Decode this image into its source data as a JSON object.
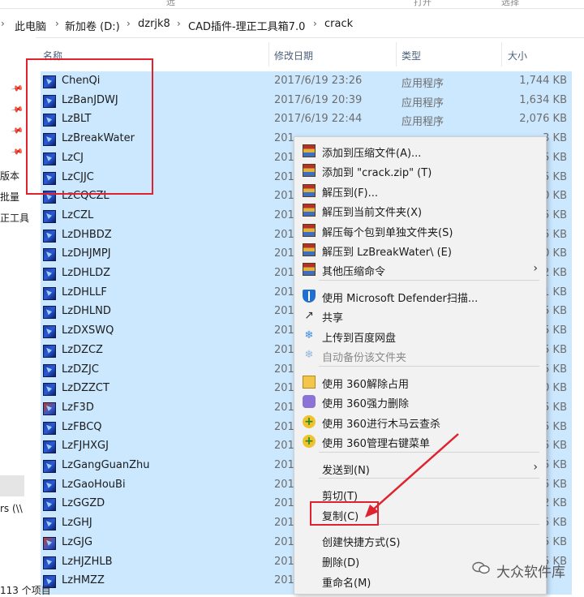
{
  "ribbon": {
    "fragments": [
      "远",
      "打开",
      "选择"
    ]
  },
  "address_bar": {
    "crumbs": [
      "此电脑",
      "新加卷 (D:)",
      "dzrjk8",
      "CAD插件-理正工具箱7.0",
      "crack"
    ]
  },
  "nav_pane": {
    "items": [
      "版本",
      "批量",
      "正工具",
      "rs (\\\\"
    ]
  },
  "columns": {
    "name": "名称",
    "date": "修改日期",
    "type": "类型",
    "size": "大小"
  },
  "files": [
    {
      "name": "ChenQi",
      "date": "2017/6/19 23:26",
      "type": "应用程序",
      "size": "1,744 KB"
    },
    {
      "name": "LzBanJDWJ",
      "date": "2017/6/19 20:39",
      "type": "应用程序",
      "size": "1,634 KB"
    },
    {
      "name": "LzBLT",
      "date": "2017/6/19 22:44",
      "type": "应用程序",
      "size": "2,076 KB"
    },
    {
      "name": "LzBreakWater",
      "date": "201",
      "type": "",
      "size": "3 KB"
    },
    {
      "name": "LzCJ",
      "date": "201",
      "type": "",
      "size": "5 KB"
    },
    {
      "name": "LzCJJC",
      "date": "201",
      "type": "",
      "size": "5 KB"
    },
    {
      "name": "LzCQCZL",
      "date": "201",
      "type": "",
      "size": "0 KB"
    },
    {
      "name": "LzCZL",
      "date": "201",
      "type": "",
      "size": "5 KB"
    },
    {
      "name": "LzDHBDZ",
      "date": "201",
      "type": "",
      "size": "5 KB"
    },
    {
      "name": "LzDHJMPJ",
      "date": "201",
      "type": "",
      "size": "0 KB"
    },
    {
      "name": "LzDHLDZ",
      "date": "201",
      "type": "",
      "size": "2 KB"
    },
    {
      "name": "LzDHLLF",
      "date": "201",
      "type": "",
      "size": "1 KB"
    },
    {
      "name": "LzDHLND",
      "date": "201",
      "type": "",
      "size": "5 KB"
    },
    {
      "name": "LzDXSWQ",
      "date": "201",
      "type": "",
      "size": "5 KB"
    },
    {
      "name": "LzDZCZ",
      "date": "201",
      "type": "",
      "size": "5 KB"
    },
    {
      "name": "LzDZJC",
      "date": "201",
      "type": "",
      "size": "5 KB"
    },
    {
      "name": "LzDZZCT",
      "date": "201",
      "type": "",
      "size": "0 KB"
    },
    {
      "name": "LzF3D",
      "date": "201",
      "type": "",
      "size": "5 KB"
    },
    {
      "name": "LzFBCQ",
      "date": "201",
      "type": "",
      "size": "5 KB"
    },
    {
      "name": "LzFJHXGJ",
      "date": "201",
      "type": "",
      "size": "5 KB"
    },
    {
      "name": "LzGangGuanZhu",
      "date": "201",
      "type": "",
      "size": "5 KB"
    },
    {
      "name": "LzGaoHouBi",
      "date": "201",
      "type": "",
      "size": "5 KB"
    },
    {
      "name": "LzGGZD",
      "date": "201",
      "type": "",
      "size": "2 KB"
    },
    {
      "name": "LzGHJ",
      "date": "201",
      "type": "",
      "size": "5 KB"
    },
    {
      "name": "LzGJG",
      "date": "201",
      "type": "",
      "size": "5 KB"
    },
    {
      "name": "LzHJZHLB",
      "date": "201",
      "type": "",
      "size": "5 KB"
    },
    {
      "name": "LzHMZZ",
      "date": "201",
      "type": "",
      "size": ""
    }
  ],
  "context_menu": {
    "items": [
      {
        "label": "添加到压缩文件(A)...",
        "icon": "rar-archive-icon",
        "submenu": false,
        "disabled": false
      },
      {
        "label": "添加到 \"crack.zip\" (T)",
        "icon": "rar-archive-icon",
        "submenu": false,
        "disabled": false
      },
      {
        "label": "解压到(F)...",
        "icon": "rar-archive-icon",
        "submenu": false,
        "disabled": false
      },
      {
        "label": "解压到当前文件夹(X)",
        "icon": "rar-archive-icon",
        "submenu": false,
        "disabled": false
      },
      {
        "label": "解压每个包到单独文件夹(S)",
        "icon": "rar-archive-icon",
        "submenu": false,
        "disabled": false
      },
      {
        "label": "解压到 LzBreakWater\\ (E)",
        "icon": "rar-archive-icon",
        "submenu": false,
        "disabled": false
      },
      {
        "label": "其他压缩命令",
        "icon": "rar-archive-icon",
        "submenu": true,
        "disabled": false
      },
      {
        "label": "使用 Microsoft Defender扫描...",
        "icon": "defender-shield-icon",
        "submenu": false,
        "disabled": false
      },
      {
        "label": "共享",
        "icon": "share-icon",
        "submenu": false,
        "disabled": false
      },
      {
        "label": "上传到百度网盘",
        "icon": "baidu-cloud-icon",
        "submenu": false,
        "disabled": false
      },
      {
        "label": "自动备份该文件夹",
        "icon": "baidu-cloud-icon",
        "submenu": false,
        "disabled": true
      },
      {
        "label": "使用 360解除占用",
        "icon": "360-unlock-icon",
        "submenu": false,
        "disabled": false
      },
      {
        "label": "使用 360强力删除",
        "icon": "360-shred-icon",
        "submenu": false,
        "disabled": false
      },
      {
        "label": "使用 360进行木马云查杀",
        "icon": "360-scan-icon",
        "submenu": false,
        "disabled": false
      },
      {
        "label": "使用 360管理右键菜单",
        "icon": "360-manage-icon",
        "submenu": false,
        "disabled": false
      },
      {
        "label": "发送到(N)",
        "icon": "",
        "submenu": true,
        "disabled": false
      },
      {
        "label": "剪切(T)",
        "icon": "",
        "submenu": false,
        "disabled": false
      },
      {
        "label": "复制(C)",
        "icon": "",
        "submenu": false,
        "disabled": false
      },
      {
        "label": "创建快捷方式(S)",
        "icon": "",
        "submenu": false,
        "disabled": false
      },
      {
        "label": "删除(D)",
        "icon": "",
        "submenu": false,
        "disabled": false
      },
      {
        "label": "重命名(M)",
        "icon": "",
        "submenu": false,
        "disabled": false
      }
    ]
  },
  "status_bar": {
    "count_text": "113 个项目"
  },
  "watermark": {
    "text": "大众软件库"
  },
  "colors": {
    "selection": "#cce8ff",
    "annotation_red": "#e0222f",
    "menu_bg": "#f2f2f2"
  }
}
